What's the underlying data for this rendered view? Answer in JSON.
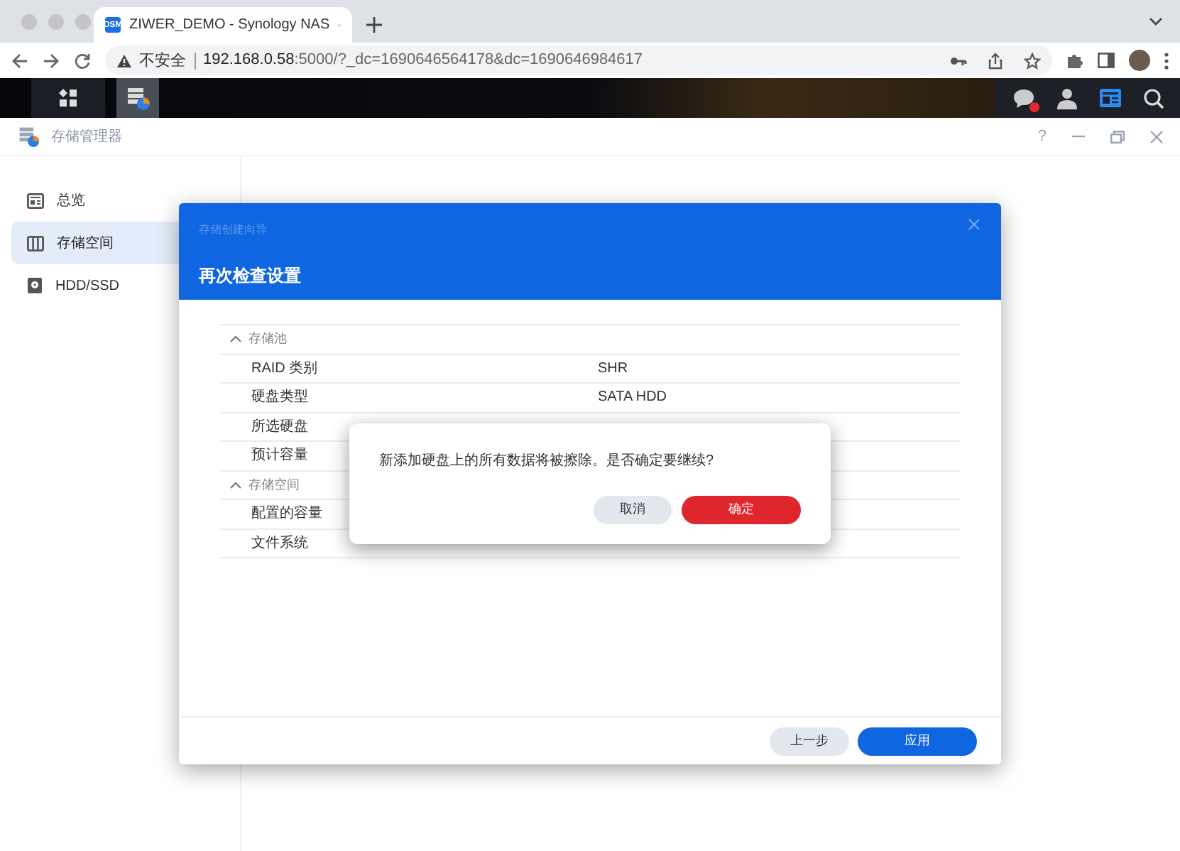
{
  "browser": {
    "tab": {
      "favicon": "DSM",
      "title": "ZIWER_DEMO - Synology NAS"
    },
    "address": {
      "security": "不安全",
      "host": "192.168.0.58",
      "path": ":5000/?_dc=1690646564178&dc=1690646984617"
    }
  },
  "taskbar": {
    "unread": true
  },
  "app": {
    "title": "存储管理器",
    "help": "?"
  },
  "sidebar": [
    {
      "label": "总览",
      "selected": false
    },
    {
      "label": "存储空间",
      "selected": true
    },
    {
      "label": "HDD/SSD",
      "selected": false
    }
  ],
  "wizard": {
    "caption": "存储创建向导",
    "heading": "再次检查设置",
    "sections": [
      {
        "title": "存储池",
        "expanded": true,
        "rows": [
          {
            "label": "RAID 类别",
            "value": "SHR"
          },
          {
            "label": "硬盘类型",
            "value": "SATA HDD"
          },
          {
            "label": "所选硬盘"
          },
          {
            "label": "预计容量"
          }
        ]
      },
      {
        "title": "存储空间",
        "expanded": true,
        "rows": [
          {
            "label": "配置的容量"
          },
          {
            "label": "文件系统"
          }
        ]
      }
    ],
    "buttons": [
      {
        "label": "上一步",
        "primary": false
      },
      {
        "label": "应用",
        "primary": true
      }
    ]
  },
  "confirm": {
    "message": "新添加硬盘上的所有数据将被擦除。是否确定要继续?",
    "buttons": [
      {
        "label": "取消",
        "kind": "secondary"
      },
      {
        "label": "确定",
        "kind": "danger"
      }
    ]
  }
}
